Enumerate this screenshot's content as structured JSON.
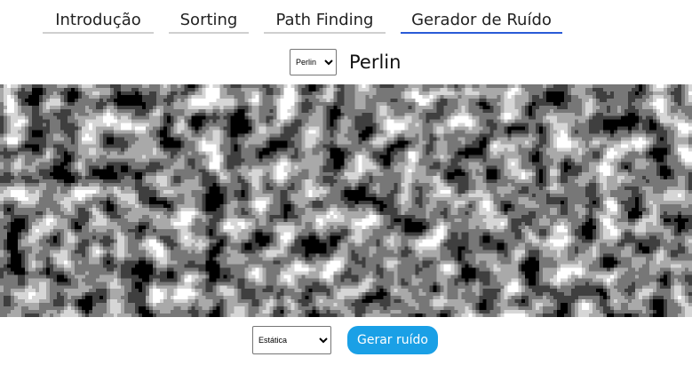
{
  "nav": {
    "tabs": [
      {
        "label": "Introdução",
        "active": false
      },
      {
        "label": "Sorting",
        "active": false
      },
      {
        "label": "Path Finding",
        "active": false
      },
      {
        "label": "Gerador de Ruído",
        "active": true
      }
    ]
  },
  "algorithm": {
    "options": [
      "Perlin"
    ],
    "selected": "Perlin",
    "title": "Perlin"
  },
  "noise": {
    "palette": [
      "#000000",
      "#3f3f3f",
      "#777777",
      "#a9a9a9",
      "#d6d6d6",
      "#ffffff"
    ]
  },
  "controls": {
    "mode_options": [
      "Estática"
    ],
    "mode_selected": "Estática",
    "generate_label": "Gerar ruído"
  },
  "colors": {
    "accent": "#2a5bd7",
    "button": "#1aa0e6"
  }
}
